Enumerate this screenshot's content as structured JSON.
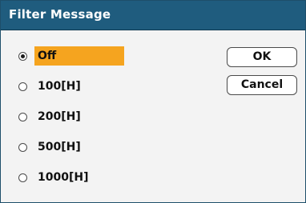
{
  "dialog": {
    "title": "Filter Message"
  },
  "options": [
    {
      "label": "Off",
      "checked": true
    },
    {
      "label": "100[H]",
      "checked": false
    },
    {
      "label": "200[H]",
      "checked": false
    },
    {
      "label": "500[H]",
      "checked": false
    },
    {
      "label": "1000[H]",
      "checked": false
    }
  ],
  "buttons": {
    "ok_label": "OK",
    "cancel_label": "Cancel"
  },
  "colors": {
    "titlebar": "#1f5c7e",
    "selection_highlight": "#f5a41f",
    "background": "#f3f3f3"
  }
}
